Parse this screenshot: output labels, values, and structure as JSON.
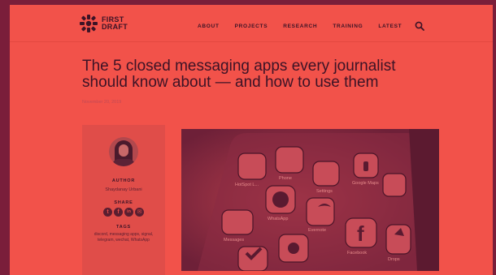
{
  "header": {
    "logo": {
      "line1": "FIRST",
      "line2": "DRAFT"
    },
    "nav": [
      "ABOUT",
      "PROJECTS",
      "RESEARCH",
      "TRAINING",
      "LATEST"
    ]
  },
  "article": {
    "title": "The 5 closed messaging apps every journalist should know about — and how to use them",
    "date": "November 20, 2019"
  },
  "sidebar": {
    "author_label": "AUTHOR",
    "author_name": "Shaydanay Urbani",
    "share_label": "SHARE",
    "share_icons": [
      "twitter-icon",
      "facebook-icon",
      "linkedin-icon",
      "email-icon"
    ],
    "share_glyphs": [
      "t",
      "f",
      "in",
      "✉"
    ],
    "tags_label": "TAGS",
    "tags": "discord, messaging apps, signal, telegram, wechat, WhatsApp"
  },
  "hero": {
    "app_labels": [
      "HotSpot L...",
      "Phone",
      "Settings",
      "Google Maps",
      "WhatsApp",
      "Evernote",
      "Messages",
      "Facebook",
      "Drops"
    ]
  }
}
